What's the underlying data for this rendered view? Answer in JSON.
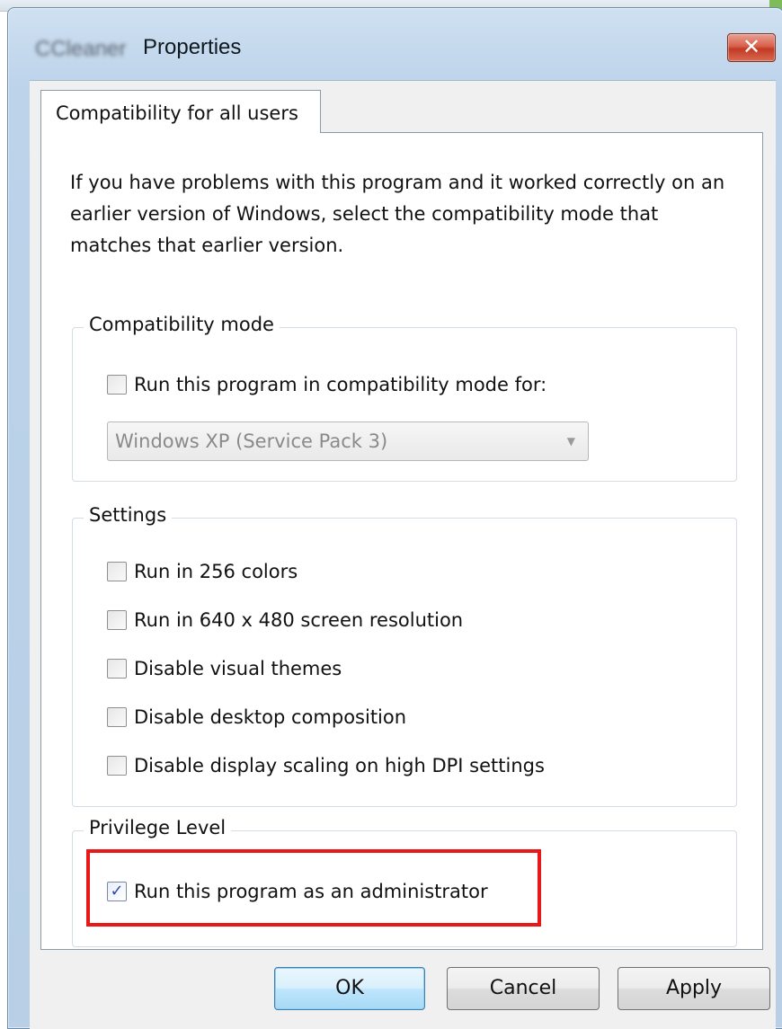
{
  "window": {
    "app_name": "CCleaner",
    "title": "Properties",
    "close_glyph": "✕"
  },
  "tabs": [
    {
      "label": "Compatibility for all users",
      "active": true
    }
  ],
  "intro_text": "If you have problems with this program and it worked correctly on an earlier version of Windows, select the compatibility mode that matches that earlier version.",
  "compatibility_mode": {
    "group_title": "Compatibility mode",
    "checkbox_label": "Run this program in compatibility mode for:",
    "checked": false,
    "dropdown_value": "Windows XP (Service Pack 3)",
    "dropdown_enabled": false
  },
  "settings": {
    "group_title": "Settings",
    "items": [
      {
        "label": "Run in 256 colors",
        "checked": false
      },
      {
        "label": "Run in 640 x 480 screen resolution",
        "checked": false
      },
      {
        "label": "Disable visual themes",
        "checked": false
      },
      {
        "label": "Disable desktop composition",
        "checked": false
      },
      {
        "label": "Disable display scaling on high DPI settings",
        "checked": false
      }
    ]
  },
  "privilege_level": {
    "group_title": "Privilege Level",
    "checkbox_label": "Run this program as an administrator",
    "checked": true,
    "check_glyph": "✓"
  },
  "buttons": {
    "ok": "OK",
    "cancel": "Cancel",
    "apply": "Apply"
  },
  "colors": {
    "highlight": "#e81818",
    "close_button": "#c8432d",
    "default_button": "#bee6fd"
  }
}
